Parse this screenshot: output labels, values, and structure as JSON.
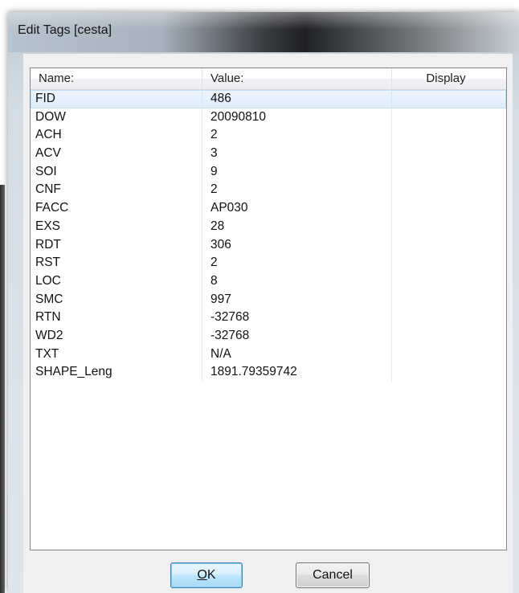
{
  "window": {
    "title": "Edit Tags [cesta]"
  },
  "table": {
    "columns": [
      "Name:",
      "Value:",
      "Display"
    ],
    "selected_row_index": 0,
    "rows": [
      {
        "name": "FID",
        "value": "486",
        "display": ""
      },
      {
        "name": "DOW",
        "value": "20090810",
        "display": ""
      },
      {
        "name": "ACH",
        "value": "2",
        "display": ""
      },
      {
        "name": "ACV",
        "value": "3",
        "display": ""
      },
      {
        "name": "SOI",
        "value": "9",
        "display": ""
      },
      {
        "name": "CNF",
        "value": "2",
        "display": ""
      },
      {
        "name": "FACC",
        "value": "AP030",
        "display": ""
      },
      {
        "name": "EXS",
        "value": "28",
        "display": ""
      },
      {
        "name": "RDT",
        "value": "306",
        "display": ""
      },
      {
        "name": "RST",
        "value": "2",
        "display": ""
      },
      {
        "name": "LOC",
        "value": "8",
        "display": ""
      },
      {
        "name": "SMC",
        "value": "997",
        "display": ""
      },
      {
        "name": "RTN",
        "value": "-32768",
        "display": ""
      },
      {
        "name": "WD2",
        "value": "-32768",
        "display": ""
      },
      {
        "name": "TXT",
        "value": "N/A",
        "display": ""
      },
      {
        "name": "SHAPE_Leng",
        "value": "1891.79359742",
        "display": ""
      }
    ]
  },
  "buttons": {
    "ok_mnemonic": "O",
    "ok_rest": "K",
    "cancel_label": "Cancel"
  }
}
